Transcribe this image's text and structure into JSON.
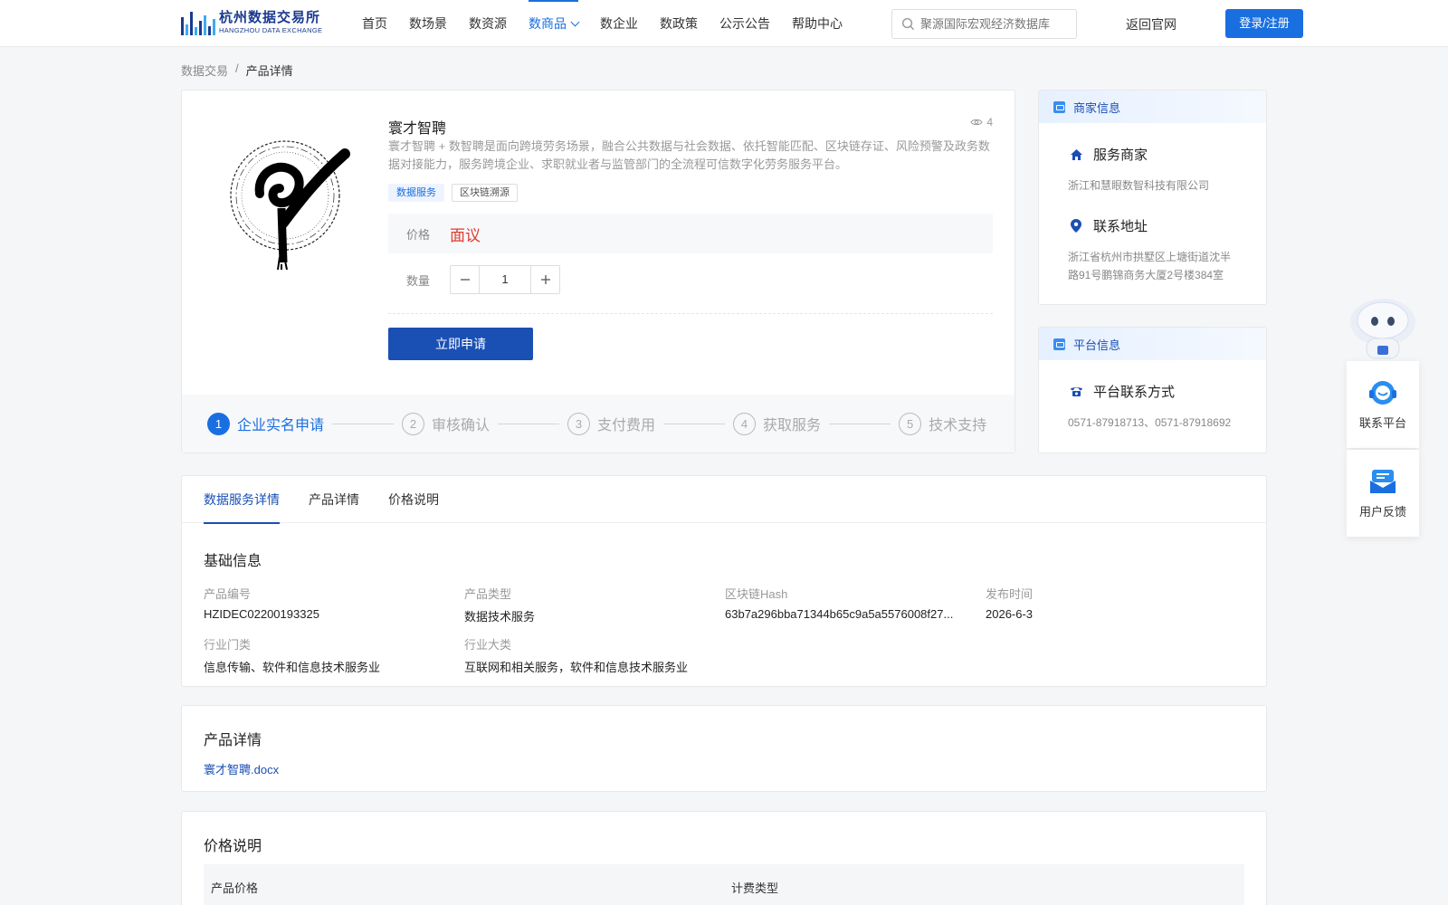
{
  "header": {
    "logo_cn": "杭州数据交易所",
    "logo_en": "HANGZHOU DATA EXCHANGE",
    "nav": [
      {
        "label": "首页"
      },
      {
        "label": "数场景"
      },
      {
        "label": "数资源"
      },
      {
        "label": "数商品",
        "active": true
      },
      {
        "label": "数企业"
      },
      {
        "label": "数政策"
      },
      {
        "label": "公示公告"
      },
      {
        "label": "帮助中心"
      }
    ],
    "search_placeholder": "聚源国际宏观经济数据库",
    "back_link": "返回官网",
    "login_button": "登录/注册",
    "accent_color": "#1a6fe0"
  },
  "breadcrumb": {
    "parent": "数据交易",
    "separator": "/",
    "current": "产品详情"
  },
  "product": {
    "title": "寰才智聘",
    "views": "4",
    "description": "寰才智聘 + 数智聘是面向跨境劳务场景，融合公共数据与社会数据、依托智能匹配、区块链存证、风险预警及政务数据对接能力，服务跨境企业、求职就业者与监管部门的全流程可信数字化劳务服务平台。",
    "tags": [
      "数据服务",
      "区块链溯源"
    ],
    "price_label": "价格",
    "price_value": "面议",
    "quantity_label": "数量",
    "quantity_value": "1",
    "apply_button": "立即申请",
    "steps": [
      {
        "num": "1",
        "label": "企业实名申请",
        "active": true
      },
      {
        "num": "2",
        "label": "审核确认"
      },
      {
        "num": "3",
        "label": "支付费用"
      },
      {
        "num": "4",
        "label": "获取服务"
      },
      {
        "num": "5",
        "label": "技术支持"
      }
    ]
  },
  "merchant": {
    "heading": "商家信息",
    "service_title": "服务商家",
    "service_value": "浙江和慧眼数智科技有限公司",
    "address_title": "联系地址",
    "address_value": "浙江省杭州市拱墅区上塘街道沈半路91号鹏锦商务大厦2号楼384室"
  },
  "platform": {
    "heading": "平台信息",
    "contact_title": "平台联系方式",
    "contact_value": "0571-87918713、0571-87918692"
  },
  "floating": {
    "contact_label": "联系平台",
    "feedback_label": "用户反馈"
  },
  "detail": {
    "tabs": [
      {
        "label": "数据服务详情",
        "active": true
      },
      {
        "label": "产品详情"
      },
      {
        "label": "价格说明"
      }
    ],
    "basic_title": "基础信息",
    "fields": [
      {
        "key": "产品编号",
        "value": "HZIDEC02200193325"
      },
      {
        "key": "产品类型",
        "value": "数据技术服务"
      },
      {
        "key": "区块链Hash",
        "value": "63b7a296bba71344b65c9a5a5576008f27..."
      },
      {
        "key": "发布时间",
        "value": "2026-6-3"
      },
      {
        "key": "行业门类",
        "value": "信息传输、软件和信息技术服务业"
      },
      {
        "key": "行业大类",
        "value": "互联网和相关服务，软件和信息技术服务业"
      }
    ]
  },
  "product_detail": {
    "title": "产品详情",
    "file": "寰才智聘.docx"
  },
  "price_info": {
    "title": "价格说明",
    "columns": [
      "产品价格",
      "计费类型"
    ]
  }
}
